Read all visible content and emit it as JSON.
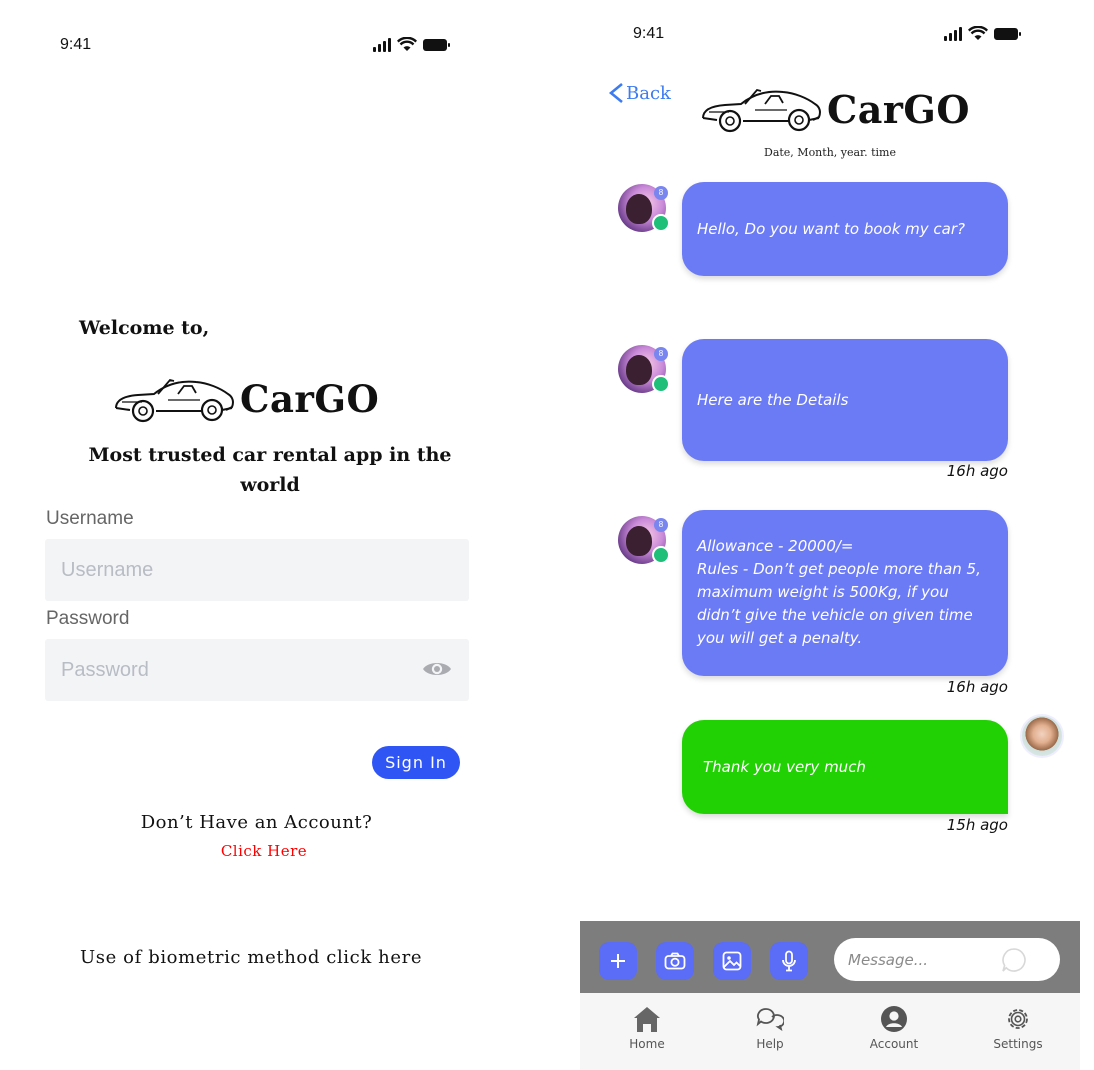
{
  "login": {
    "status": {
      "time": "9:41"
    },
    "welcome": "Welcome to,",
    "brand": "CarGO",
    "tagline": "Most trusted car rental app in the world",
    "username": {
      "label": "Username",
      "placeholder": "Username",
      "value": ""
    },
    "password": {
      "label": "Password",
      "placeholder": "Password",
      "value": ""
    },
    "signin_label": "Sign In",
    "no_account": "Don’t Have an Account?",
    "click_here": "Click Here",
    "biometric": "Use of biometric method click here",
    "colors": {
      "primary": "#2f55f5",
      "link": "#ff0000",
      "field_bg": "#f3f4f6"
    }
  },
  "chat": {
    "status": {
      "time": "9:41"
    },
    "back_label": "Back",
    "brand": "CarGO",
    "datetime": "Date, Month, year. time",
    "messages": [
      {
        "direction": "in",
        "text": "Hello, Do you want to book my car?",
        "time": "",
        "avatar_badge": "8"
      },
      {
        "direction": "in",
        "text": "Here are the Details",
        "time": "16h ago",
        "avatar_badge": "8"
      },
      {
        "direction": "in",
        "lines": [
          "Allowance - 20000/=",
          "Rules - Don’t get people more than 5, maximum weight is 500Kg, if you didn’t give the vehicle on given time you will get a penalty."
        ],
        "time": "16h ago",
        "avatar_badge": "8"
      },
      {
        "direction": "out",
        "text": "Thank you very much",
        "time": "15h ago"
      }
    ],
    "composer": {
      "placeholder": "Message...",
      "value": ""
    },
    "tabs": [
      {
        "label": "Home",
        "icon": "home-icon"
      },
      {
        "label": "Help",
        "icon": "chat-bubbles-icon"
      },
      {
        "label": "Account",
        "icon": "account-icon"
      },
      {
        "label": "Settings",
        "icon": "gear-icon"
      }
    ],
    "colors": {
      "incoming": "#6b7af5",
      "outgoing": "#21d103",
      "accent": "#5b6cf6",
      "back": "#3d7bf0"
    }
  }
}
